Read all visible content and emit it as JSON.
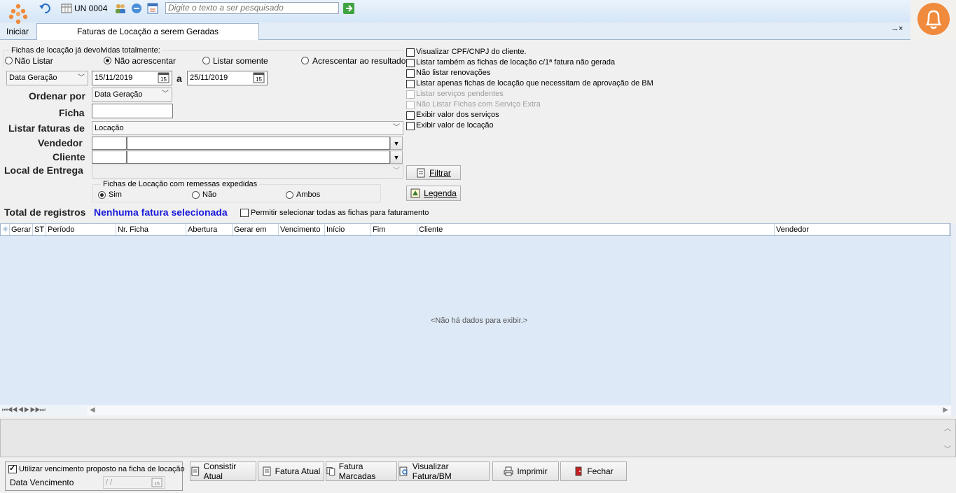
{
  "app": {
    "start_label": "Iniciar",
    "unit_label": "UN 0004",
    "search_placeholder": "Digite o texto a ser pesquisado",
    "tab_title": "Faturas de Locação a serem Geradas",
    "tab_controls": "→×"
  },
  "filters": {
    "devolvidas_title": "Fichas de locação já devolvidas totalmente:",
    "devolvidas_options": [
      "Não Listar",
      "Não acrescentar",
      "Listar somente",
      "Acrescentar ao resultado"
    ],
    "devolvidas_selected": 1,
    "date_type": "Data Geração",
    "date_from": "15/11/2019",
    "date_sep": "a",
    "date_to": "25/11/2019",
    "order_label": "Ordenar por",
    "order_value": "Data Geração",
    "ficha_label": "Ficha",
    "ficha_value": "",
    "listar_label": "Listar faturas de",
    "listar_value": "Locação",
    "vendedor_label": "Vendedor",
    "cliente_label": "Cliente",
    "local_label": "Local de Entrega",
    "remessas_title": "Fichas de Locação com remessas expedidas",
    "remessas_options": [
      "Sim",
      "Não",
      "Ambos"
    ],
    "remessas_selected": 0,
    "filtrar_label": "Filtrar",
    "legenda_label": "Legenda"
  },
  "options": [
    {
      "label": "Visualizar CPF/CNPJ do cliente.",
      "checked": false,
      "disabled": false
    },
    {
      "label": "Listar também as fichas de locação c/1ª fatura não gerada",
      "checked": false,
      "disabled": false
    },
    {
      "label": "Não listar renovações",
      "checked": false,
      "disabled": false
    },
    {
      "label": "Listar apenas fichas de locação que necessitam de aprovação de BM",
      "checked": false,
      "disabled": false
    },
    {
      "label": "Listar serviços pendentes",
      "checked": false,
      "disabled": true
    },
    {
      "label": "Não Listar Fichas com Serviço Extra",
      "checked": false,
      "disabled": true
    },
    {
      "label": "Exibir valor dos serviços",
      "checked": false,
      "disabled": false
    },
    {
      "label": "Exibir valor de locação",
      "checked": false,
      "disabled": false
    }
  ],
  "totals": {
    "label": "Total de registros",
    "value": "Nenhuma fatura selecionada",
    "select_all_label": "Permitir selecionar todas as fichas para faturamento"
  },
  "grid": {
    "columns": [
      "Gerar",
      "ST",
      "Período",
      "Nr. Ficha",
      "Abertura",
      "Gerar em",
      "Vencimento",
      "Início",
      "Fim",
      "Cliente",
      "Vendedor"
    ],
    "empty_text": "<Não há dados para exibir.>"
  },
  "footer": {
    "use_vencimento_label": "Utilizar vencimento proposto na ficha de locação",
    "use_vencimento_checked": true,
    "data_vencimento_label": "Data Vencimento",
    "data_vencimento_value": " / /",
    "buttons": [
      "Consistir Atual",
      "Fatura Atual",
      "Fatura Marcadas",
      "Visualizar Fatura/BM",
      "Imprimir",
      "Fechar"
    ]
  },
  "colors": {
    "accent_blue": "#1a1adb",
    "grid_bg": "#dde9f6",
    "bell_orange": "#f08a3c"
  }
}
